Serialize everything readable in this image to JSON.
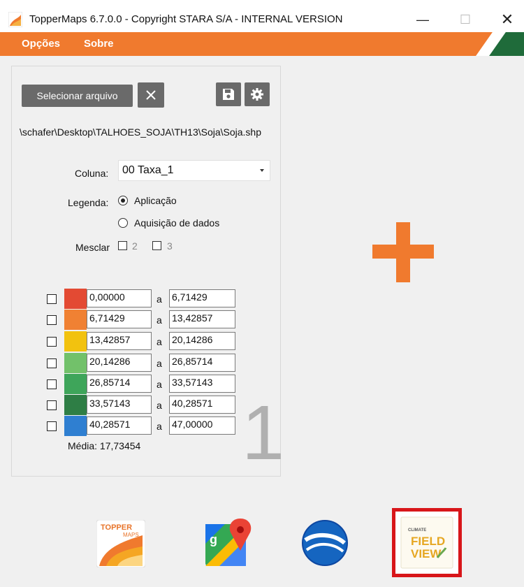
{
  "window": {
    "title": "TopperMaps 6.7.0.0 - Copyright STARA S/A  - INTERNAL VERSION",
    "minimize": "—",
    "maximize": "☐",
    "close": "✕"
  },
  "menu": {
    "items": [
      "Opções",
      "Sobre"
    ],
    "accent_color": "#f07a2e",
    "brand_green": "#1f6b3a"
  },
  "file": {
    "select_button": "Selecionar arquivo",
    "clear_icon": "close-icon",
    "save_icon": "save-icon",
    "settings_icon": "gear-icon",
    "path": "\\schafer\\Desktop\\TALHOES_SOJA\\TH13\\Soja\\Soja.shp"
  },
  "coluna": {
    "label": "Coluna:",
    "value": "00 Taxa_1"
  },
  "legenda": {
    "label": "Legenda:",
    "options": [
      "Aplicação",
      "Aquisição de dados"
    ],
    "selected": "Aplicação"
  },
  "mesclar": {
    "label": "Mesclar",
    "options": [
      "2",
      "3"
    ]
  },
  "ranges": [
    {
      "from": "0,00000",
      "to": "6,71429",
      "color": "#e34a33"
    },
    {
      "from": "6,71429",
      "to": "13,42857",
      "color": "#f08133"
    },
    {
      "from": "13,42857",
      "to": "20,14286",
      "color": "#f2c20f"
    },
    {
      "from": "20,14286",
      "to": "26,85714",
      "color": "#72c16a"
    },
    {
      "from": "26,85714",
      "to": "33,57143",
      "color": "#3ea55a"
    },
    {
      "from": "33,57143",
      "to": "40,28571",
      "color": "#2e7e45"
    },
    {
      "from": "40,28571",
      "to": "47,00000",
      "color": "#2f7fd1"
    }
  ],
  "range_separator": "a",
  "media": "Média: 17,73454",
  "panel_number": "1",
  "add_icon": "plus-icon",
  "apps": {
    "topper": {
      "icon": "toppermaps-icon",
      "text_line1": "TOPPER",
      "text_line2": "MAPS"
    },
    "maps": {
      "icon": "google-maps-icon"
    },
    "earth": {
      "icon": "google-earth-icon"
    },
    "fieldview": {
      "icon": "climate-fieldview-icon",
      "text_top": "CLIMATE",
      "text_line1": "FIELD",
      "text_line2": "VIEW"
    }
  }
}
